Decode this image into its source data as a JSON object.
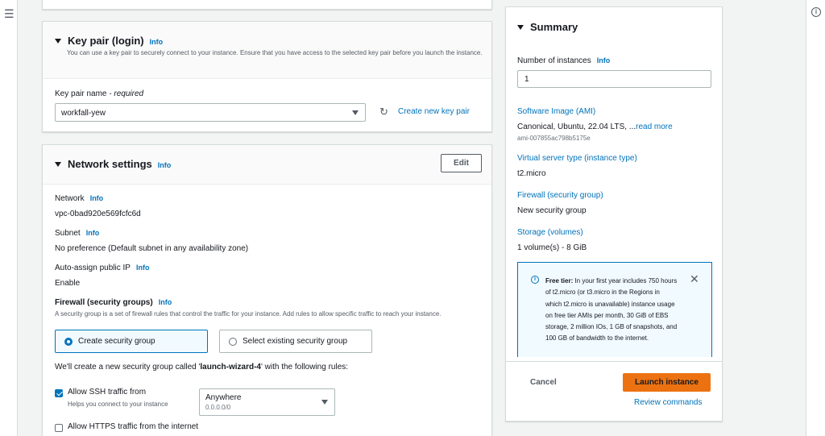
{
  "left_rail": {
    "menu_icon": "☰"
  },
  "right_rail": {
    "info_icon": "i"
  },
  "key_pair": {
    "title": "Key pair (login)",
    "info": "Info",
    "description": "You can use a key pair to securely connect to your instance. Ensure that you have access to the selected key pair before you launch the instance.",
    "name_label": "Key pair name",
    "required": " - required",
    "selected": "workfall-yew",
    "create_link": "Create new key pair",
    "refresh_icon": "↻"
  },
  "network": {
    "title": "Network settings",
    "info": "Info",
    "edit_label": "Edit",
    "network_label": "Network",
    "network_value": "vpc-0bad920e569fcfc6d",
    "subnet_label": "Subnet",
    "subnet_value": "No preference (Default subnet in any availability zone)",
    "auto_ip_label": "Auto-assign public IP",
    "auto_ip_value": "Enable",
    "firewall_label": "Firewall (security groups)",
    "firewall_desc": "A security group is a set of firewall rules that control the traffic for your instance. Add rules to allow specific traffic to reach your instance.",
    "radio_create": "Create security group",
    "radio_existing": "Select existing security group",
    "rules_text_prefix": "We'll create a new security group called '",
    "rules_group_name": "launch-wizard-4",
    "rules_text_suffix": "' with the following rules:",
    "ssh_label": "Allow SSH traffic from",
    "ssh_help": "Helps you connect to your instance",
    "ssh_select": "Anywhere",
    "ssh_cidr": "0.0.0.0/0",
    "https_label": "Allow HTTPS traffic from the internet"
  },
  "summary": {
    "title": "Summary",
    "instances_label": "Number of instances",
    "info": "Info",
    "instances_value": "1",
    "ami_label": "Software Image (AMI)",
    "ami_value": "Canonical, Ubuntu, 22.04 LTS, ...",
    "read_more": "read more",
    "ami_id": "ami-007855ac798b5175e",
    "server_type_label": "Virtual server type (instance type)",
    "server_type_value": "t2.micro",
    "firewall_label": "Firewall (security group)",
    "firewall_value": "New security group",
    "storage_label": "Storage (volumes)",
    "storage_value": "1 volume(s) - 8 GiB",
    "free_tier_title": "Free tier:",
    "free_tier_text": " In your first year includes 750 hours of t2.micro (or t3.micro in the Regions in which t2.micro is unavailable) instance usage on free tier AMIs per month, 30 GiB of EBS storage, 2 million IOs, 1 GB of snapshots, and 100 GB of bandwidth to the internet.",
    "close_icon": "✕",
    "cancel_label": "Cancel",
    "launch_label": "Launch instance",
    "review_label": "Review commands"
  },
  "colors": {
    "accent": "#0073bb",
    "launch": "#ec7211"
  }
}
